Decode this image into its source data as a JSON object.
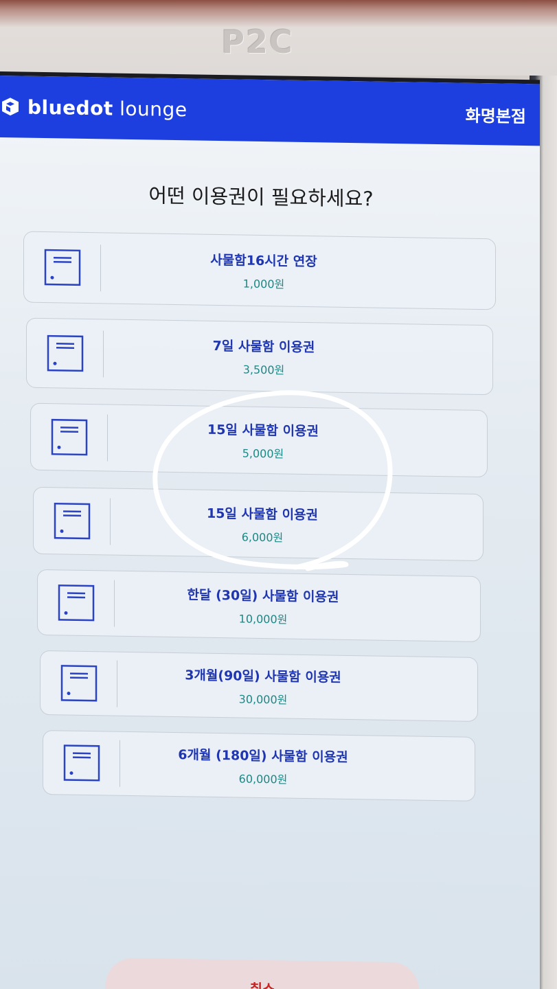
{
  "device": {
    "brand_text": "P2C"
  },
  "header": {
    "logo_bold": "bluedot",
    "logo_light": "lounge",
    "branch": "화명본점",
    "bg_color": "#1d3fe0"
  },
  "question": "어떤 이용권이 필요하세요?",
  "options": [
    {
      "title": "사물함16시간 연장",
      "price": "1,000원",
      "icon": "locker-icon"
    },
    {
      "title": "7일 사물함 이용권",
      "price": "3,500원",
      "icon": "locker-icon"
    },
    {
      "title": "15일 사물함 이용권",
      "price": "5,000원",
      "icon": "locker-icon"
    },
    {
      "title": "15일 사물함 이용권",
      "price": "6,000원",
      "icon": "locker-icon"
    },
    {
      "title": "한달 (30일) 사물함 이용권",
      "price": "10,000원",
      "icon": "locker-icon"
    },
    {
      "title": "3개월(90일) 사물함 이용권",
      "price": "30,000원",
      "icon": "locker-icon"
    },
    {
      "title": "6개월 (180일) 사물함 이용권",
      "price": "60,000원",
      "icon": "locker-icon"
    }
  ],
  "cancel_label": "취소",
  "colors": {
    "title_text": "#1f36b0",
    "price_text": "#1b8a86",
    "cancel_text": "#c82424"
  }
}
